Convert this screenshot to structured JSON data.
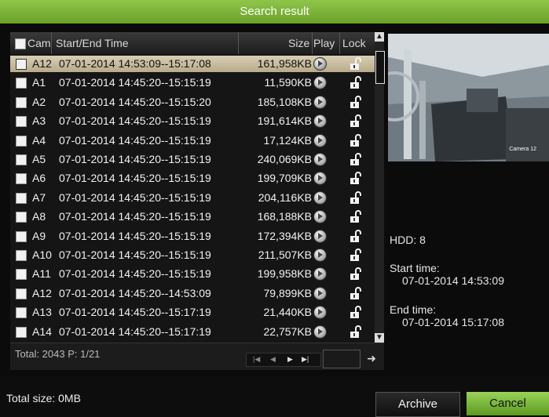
{
  "title": "Search result",
  "table": {
    "headers": {
      "cam": "Cam",
      "time": "Start/End Time",
      "size": "Size",
      "play": "Play",
      "lock": "Lock"
    },
    "rows": [
      {
        "cam": "A12",
        "time": "07-01-2014 14:53:09--15:17:08",
        "size": "161,958KB",
        "selected": true
      },
      {
        "cam": "A1",
        "time": "07-01-2014 14:45:20--15:15:19",
        "size": "11,590KB"
      },
      {
        "cam": "A2",
        "time": "07-01-2014 14:45:20--15:15:20",
        "size": "185,108KB"
      },
      {
        "cam": "A3",
        "time": "07-01-2014 14:45:20--15:15:19",
        "size": "191,614KB"
      },
      {
        "cam": "A4",
        "time": "07-01-2014 14:45:20--15:15:19",
        "size": "17,124KB"
      },
      {
        "cam": "A5",
        "time": "07-01-2014 14:45:20--15:15:19",
        "size": "240,069KB"
      },
      {
        "cam": "A6",
        "time": "07-01-2014 14:45:20--15:15:19",
        "size": "199,709KB"
      },
      {
        "cam": "A7",
        "time": "07-01-2014 14:45:20--15:15:19",
        "size": "204,116KB"
      },
      {
        "cam": "A8",
        "time": "07-01-2014 14:45:20--15:15:19",
        "size": "168,188KB"
      },
      {
        "cam": "A9",
        "time": "07-01-2014 14:45:20--15:15:19",
        "size": "172,394KB"
      },
      {
        "cam": "A10",
        "time": "07-01-2014 14:45:20--15:15:19",
        "size": "211,507KB"
      },
      {
        "cam": "A11",
        "time": "07-01-2014 14:45:20--15:15:19",
        "size": "199,958KB"
      },
      {
        "cam": "A12",
        "time": "07-01-2014 14:45:20--14:53:09",
        "size": "79,899KB"
      },
      {
        "cam": "A13",
        "time": "07-01-2014 14:45:20--15:17:19",
        "size": "21,440KB"
      },
      {
        "cam": "A14",
        "time": "07-01-2014 14:45:20--15:17:19",
        "size": "22,757KB"
      }
    ]
  },
  "footer": {
    "total": "Total: 2043  P: 1/21"
  },
  "preview": {
    "camera_label": "Camera 12"
  },
  "info": {
    "hdd": "HDD: 8",
    "start_label": "Start time:",
    "start_value": "07-01-2014 14:53:09",
    "end_label": "End time:",
    "end_value": "07-01-2014 15:17:08"
  },
  "bottom": {
    "total_size": "Total size: 0MB",
    "archive_label": "Archive",
    "cancel_label": "Cancel"
  },
  "colors": {
    "accent_green": "#7ab83a",
    "selected_row": "#c8bc9c"
  }
}
